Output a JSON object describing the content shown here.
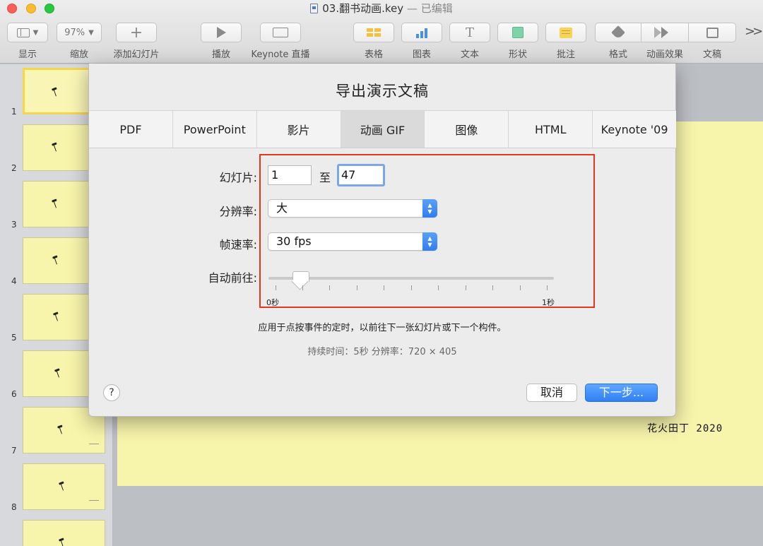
{
  "window": {
    "title": "03.翻书动画.key",
    "edited": "— 已编辑"
  },
  "toolbar": {
    "view_label": "显示",
    "zoom_value": "97%",
    "zoom_label": "缩放",
    "add_slide_label": "添加幻灯片",
    "play_label": "播放",
    "keynote_live_label": "Keynote 直播",
    "table_label": "表格",
    "chart_label": "图表",
    "text_label": "文本",
    "shape_label": "形状",
    "comment_label": "批注",
    "format_label": "格式",
    "animate_label": "动画效果",
    "document_label": "文稿",
    "add_glyph": "+",
    "text_glyph": "T",
    "overflow": ">>"
  },
  "navigator": {
    "slides": [
      "1",
      "2",
      "3",
      "4",
      "5",
      "6",
      "7",
      "8"
    ]
  },
  "canvas": {
    "signature": "花火田丁 2020"
  },
  "dialog": {
    "title": "导出演示文稿",
    "tabs": [
      "PDF",
      "PowerPoint",
      "影片",
      "动画 GIF",
      "图像",
      "HTML",
      "Keynote '09"
    ],
    "active_tab": "动画 GIF",
    "slides_label": "幻灯片:",
    "slides_from": "1",
    "slides_to_label": "至",
    "slides_to": "47",
    "resolution_label": "分辨率:",
    "resolution_value": "大",
    "framerate_label": "帧速率:",
    "framerate_value": "30 fps",
    "auto_advance_label": "自动前往:",
    "auto_advance_min": "0秒",
    "auto_advance_max": "1秒",
    "auto_advance_value": 0.1,
    "help_text": "应用于点按事件的定时，以前往下一张幻灯片或下一个构件。",
    "info_text": "持续时间：5秒   分辨率：720 × 405",
    "help_button": "?",
    "cancel_button": "取消",
    "next_button": "下一步..."
  },
  "colors": {
    "highlight_box": "#e8331d",
    "slide_background": "#f7f4ab",
    "primary_button": "#2f80f2"
  }
}
